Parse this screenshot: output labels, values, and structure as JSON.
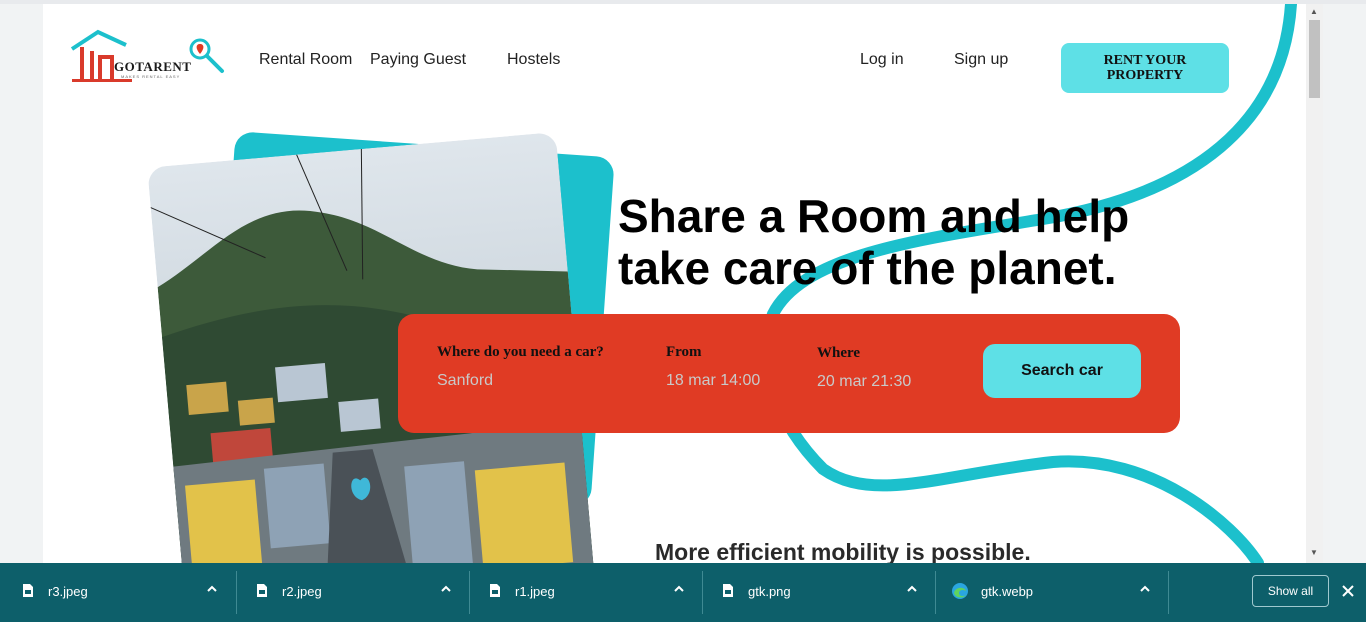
{
  "site": {
    "logo_text": "GOTARENT",
    "logo_tagline": "MAKES RENTAL EASY",
    "nav": [
      {
        "label": "Rental Room"
      },
      {
        "label": "Paying Guest"
      },
      {
        "label": "Hostels"
      }
    ],
    "login_label": "Log in",
    "signup_label": "Sign up",
    "rent_cta_line1": "RENT YOUR",
    "rent_cta_line2": "PROPERTY",
    "headline_line1": "Share a Room and help",
    "headline_line2": "take care of the planet.",
    "subheading": "More efficient mobility is possible."
  },
  "search": {
    "fields": [
      {
        "label": "Where do you need a car?",
        "value": "Sanford"
      },
      {
        "label": "From",
        "value": "18 mar 14:00"
      },
      {
        "label": "Where",
        "value": "20 mar 21:30"
      }
    ],
    "button_label": "Search car"
  },
  "downloads": {
    "items": [
      {
        "name": "r3.jpeg",
        "icon": "file-icon"
      },
      {
        "name": "r2.jpeg",
        "icon": "file-icon"
      },
      {
        "name": "r1.jpeg",
        "icon": "file-icon"
      },
      {
        "name": "gtk.png",
        "icon": "file-icon"
      },
      {
        "name": "gtk.webp",
        "icon": "edge-icon"
      }
    ],
    "show_all_label": "Show all"
  },
  "colors": {
    "accent_teal": "#5ee0e6",
    "wave_teal": "#1cc0cc",
    "search_red": "#e03b24",
    "download_bar": "#0d5f6a"
  }
}
